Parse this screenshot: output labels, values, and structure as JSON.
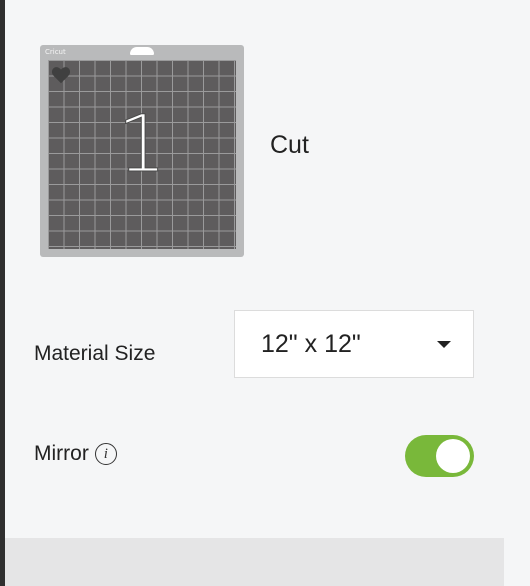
{
  "mat": {
    "brand": "Cricut",
    "number": "1",
    "label": "Cut"
  },
  "material_size": {
    "label": "Material Size",
    "selected": "12\" x 12\""
  },
  "mirror": {
    "label": "Mirror",
    "info_glyph": "i",
    "enabled": true
  },
  "colors": {
    "toggle_on": "#79b83a",
    "mat_background": "#5e5c5d",
    "mat_frame": "#b9babb"
  },
  "icons": {
    "info": "info-icon",
    "dropdown": "chevron-down-icon",
    "heart": "heart-icon"
  }
}
